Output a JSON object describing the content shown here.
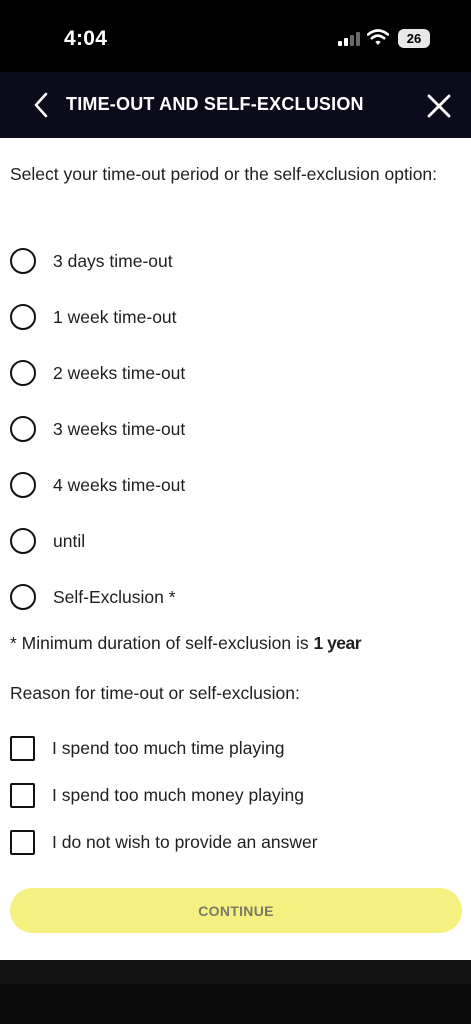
{
  "status_bar": {
    "time": "4:04",
    "battery": "26"
  },
  "header": {
    "title": "TIME-OUT AND SELF-EXCLUSION"
  },
  "form": {
    "intro": "Select your time-out period or the self-exclusion option:",
    "options": [
      {
        "label": "3 days time-out",
        "selected": false
      },
      {
        "label": "1 week time-out",
        "selected": false
      },
      {
        "label": "2 weeks time-out",
        "selected": false
      },
      {
        "label": "3 weeks time-out",
        "selected": false
      },
      {
        "label": "4 weeks time-out",
        "selected": false
      },
      {
        "label": "until",
        "selected": false
      },
      {
        "label": "Self-Exclusion *",
        "selected": false
      }
    ],
    "note_prefix": "* Minimum duration of self-exclusion is",
    "note_emphasis": "1 year",
    "reason_heading": "Reason for time-out or self-exclusion:",
    "reasons": [
      {
        "label": "I spend too much time playing",
        "checked": false
      },
      {
        "label": "I spend too much money playing",
        "checked": false
      },
      {
        "label": "I do not wish to provide an answer",
        "checked": false
      }
    ],
    "continue_label": "CONTINUE"
  },
  "colors": {
    "header_bg": "#0b0b1b",
    "continue_bg": "#f5f180",
    "continue_text": "#7a7a66"
  }
}
